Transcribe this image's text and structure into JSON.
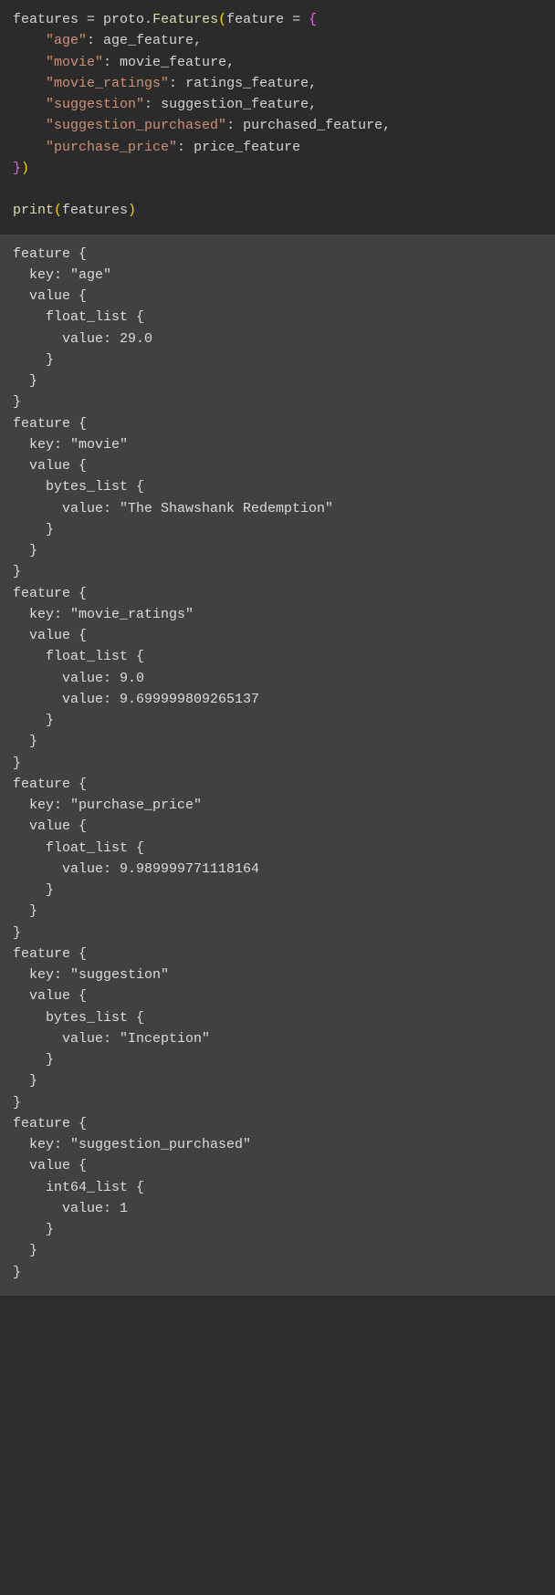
{
  "code": {
    "line1_var": "features ",
    "line1_eq": "= ",
    "line1_obj": "proto",
    "line1_dot": ".",
    "line1_func": "Features",
    "line1_arg": "feature ",
    "line1_eq2": "= ",
    "k_age": "\"age\"",
    "v_age": "age_feature",
    "k_movie": "\"movie\"",
    "v_movie": "movie_feature",
    "k_ratings": "\"movie_ratings\"",
    "v_ratings": "ratings_feature",
    "k_sugg": "\"suggestion\"",
    "v_sugg": "suggestion_feature",
    "k_purch": "\"suggestion_purchased\"",
    "v_purch": "purchased_feature",
    "k_price": "\"purchase_price\"",
    "v_price": "price_feature",
    "print": "print",
    "print_arg": "features",
    "colon_sp": ": ",
    "comma": ",",
    "indent": "    "
  },
  "output": "feature {\n  key: \"age\"\n  value {\n    float_list {\n      value: 29.0\n    }\n  }\n}\nfeature {\n  key: \"movie\"\n  value {\n    bytes_list {\n      value: \"The Shawshank Redemption\"\n    }\n  }\n}\nfeature {\n  key: \"movie_ratings\"\n  value {\n    float_list {\n      value: 9.0\n      value: 9.699999809265137\n    }\n  }\n}\nfeature {\n  key: \"purchase_price\"\n  value {\n    float_list {\n      value: 9.989999771118164\n    }\n  }\n}\nfeature {\n  key: \"suggestion\"\n  value {\n    bytes_list {\n      value: \"Inception\"\n    }\n  }\n}\nfeature {\n  key: \"suggestion_purchased\"\n  value {\n    int64_list {\n      value: 1\n    }\n  }\n}"
}
